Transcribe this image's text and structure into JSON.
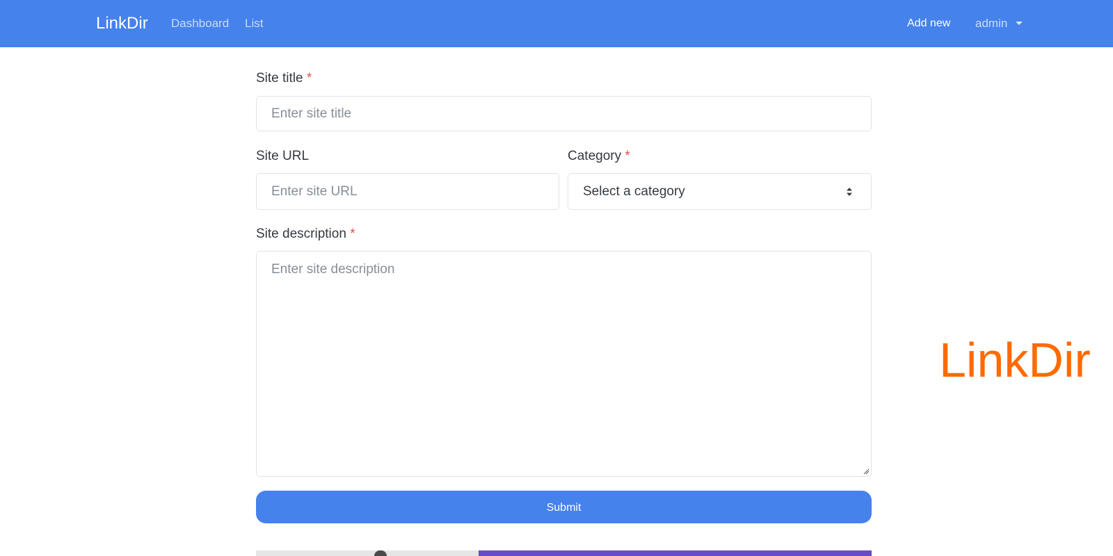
{
  "navbar": {
    "brand": "LinkDir",
    "links": [
      "Dashboard",
      "List"
    ],
    "add_new": "Add new",
    "user": "admin"
  },
  "form": {
    "site_title": {
      "label": "Site title",
      "required": "*",
      "placeholder": "Enter site title"
    },
    "site_url": {
      "label": "Site URL",
      "placeholder": "Enter site URL"
    },
    "category": {
      "label": "Category",
      "required": "*",
      "selected": "Select a category"
    },
    "site_description": {
      "label": "Site description",
      "required": "*",
      "placeholder": "Enter site description"
    },
    "submit": "Submit"
  },
  "watermark": "LinkDir",
  "colors": {
    "primary": "#4582ec",
    "required": "#d9534f",
    "watermark": "#ff6a00"
  },
  "icons": [
    "caret-down-icon",
    "select-arrows-icon",
    "resize-grip-icon"
  ]
}
